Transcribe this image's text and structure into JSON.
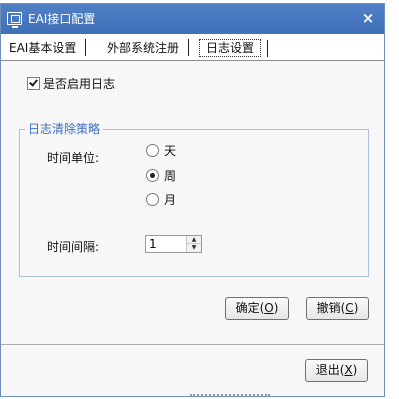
{
  "window": {
    "title": "EAI接口配置",
    "close_label": "×"
  },
  "tabs": [
    {
      "label": "EAI基本设置",
      "active": false
    },
    {
      "label": "外部系统注册",
      "active": false
    },
    {
      "label": "日志设置",
      "active": true
    }
  ],
  "log_settings": {
    "enable_log": {
      "label": "是否启用日志",
      "checked": true
    },
    "cleanup_group": {
      "title": "日志清除策略",
      "time_unit_label": "时间单位:",
      "units": [
        {
          "label": "天",
          "selected": false
        },
        {
          "label": "周",
          "selected": true
        },
        {
          "label": "月",
          "selected": false
        }
      ],
      "interval_label": "时间间隔:",
      "interval_value": "1"
    },
    "ok_label": "确定(",
    "ok_key": "O",
    "ok_tail": ")",
    "cancel_label": "撤销(",
    "cancel_key": "C",
    "cancel_tail": ")"
  },
  "footer": {
    "exit_label": "退出(",
    "exit_key": "X",
    "exit_tail": ")"
  },
  "icons": {
    "title": "window-app-icon",
    "close": "close-icon",
    "spin_up": "spin-up-icon",
    "spin_down": "spin-down-icon"
  },
  "colors": {
    "titlebar": "#4577be",
    "group_title": "#3a6cc0"
  }
}
